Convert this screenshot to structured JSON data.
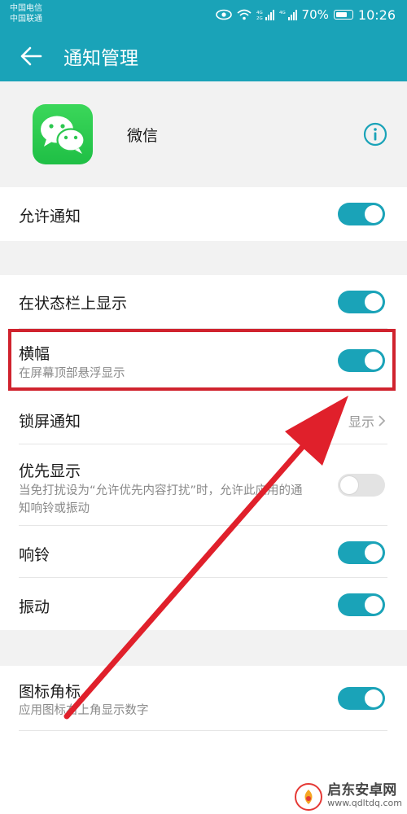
{
  "status_bar": {
    "carrier_1": "中国电信",
    "carrier_2": "中国联通",
    "battery": "70%",
    "time": "10:26"
  },
  "header": {
    "title": "通知管理",
    "accent_color": "#1aa3b8"
  },
  "app": {
    "name": "微信"
  },
  "settings": {
    "allow": {
      "label": "允许通知",
      "on": true
    },
    "status_bar": {
      "label": "在状态栏上显示",
      "on": true
    },
    "banner": {
      "label": "横幅",
      "sub": "在屏幕顶部悬浮显示",
      "on": true
    },
    "lock_screen": {
      "label": "锁屏通知",
      "value": "显示"
    },
    "priority": {
      "label": "优先显示",
      "sub": "当免打扰设为“允许优先内容打扰”时，允许此应用的通知响铃或振动",
      "on": false
    },
    "ring": {
      "label": "响铃",
      "on": true
    },
    "vibrate": {
      "label": "振动",
      "on": true
    },
    "badge": {
      "label": "图标角标",
      "sub": "应用图标右上角显示数字",
      "on": true
    }
  },
  "watermark": {
    "brand": "启东安卓网",
    "url": "www.qdltdq.com"
  }
}
